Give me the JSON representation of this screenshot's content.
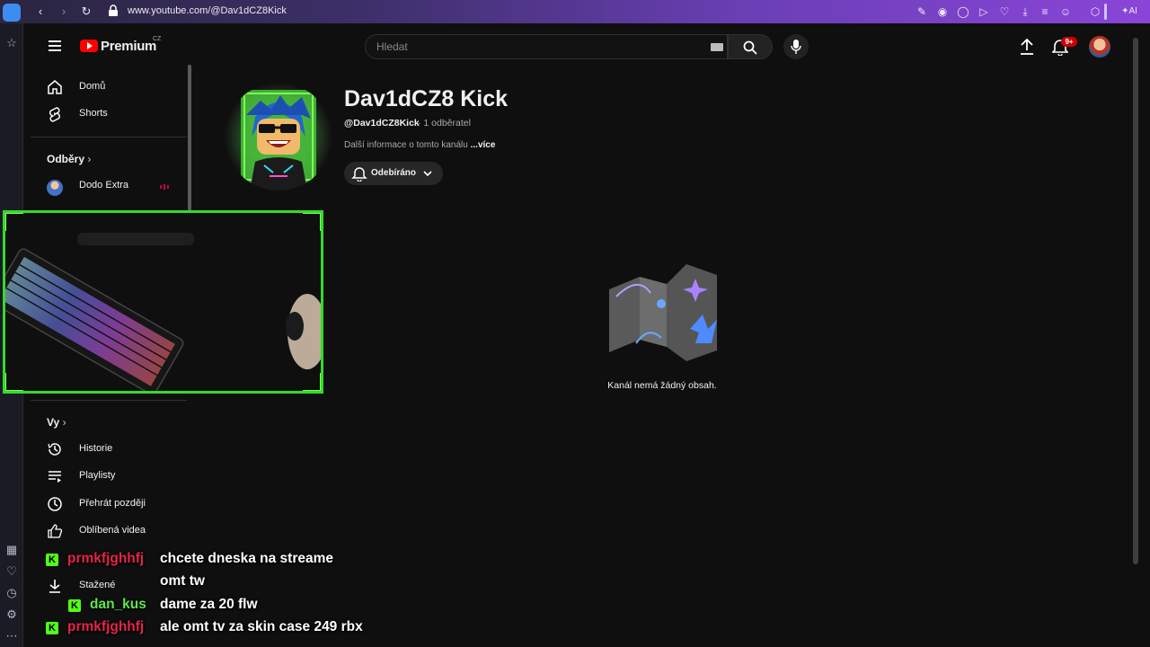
{
  "browser": {
    "url": "www.youtube.com/@Dav1dCZ8Kick",
    "ai_label": "AI"
  },
  "header": {
    "brand": "Premium",
    "country": "CZ",
    "search_placeholder": "Hledat",
    "notification_badge": "9+"
  },
  "sidebar": {
    "items_top": [
      {
        "label": "Domů",
        "icon": "home-icon"
      },
      {
        "label": "Shorts",
        "icon": "shorts-icon"
      }
    ],
    "subscriptions_heading": "Odběry",
    "subscriptions": [
      {
        "label": "Dodo Extra"
      }
    ],
    "you_heading": "Vy",
    "you_items": [
      {
        "label": "Historie",
        "icon": "history-icon"
      },
      {
        "label": "Playlisty",
        "icon": "playlist-icon"
      },
      {
        "label": "Přehrát později",
        "icon": "clock-icon"
      },
      {
        "label": "Oblíbená videa",
        "icon": "thumb-up-icon"
      },
      {
        "label": "Stažené",
        "icon": "download-icon"
      }
    ]
  },
  "channel": {
    "name": "Dav1dCZ8 Kick",
    "handle": "@Dav1dCZ8Kick",
    "subscribers": "· 1 odběratel",
    "more_info": "Další informace o tomto kanálu",
    "more_link": "...více",
    "subscribe_state": "Odebíráno",
    "empty_message": "Kanál nemá žádný obsah."
  },
  "chat": [
    {
      "user": "prmkfjghhfj",
      "message": "chcete dneska na streame"
    },
    {
      "user": "",
      "message": "omt tw"
    },
    {
      "user": "dan_kus",
      "message": "dame za 20 flw"
    },
    {
      "user": "prmkfjghhfj",
      "message": "ale omt tv za skin case 249 rbx"
    }
  ],
  "colors": {
    "kick_green": "#53fc18",
    "youtube_red": "#ff0000",
    "webcam_frame": "#35d92a"
  }
}
